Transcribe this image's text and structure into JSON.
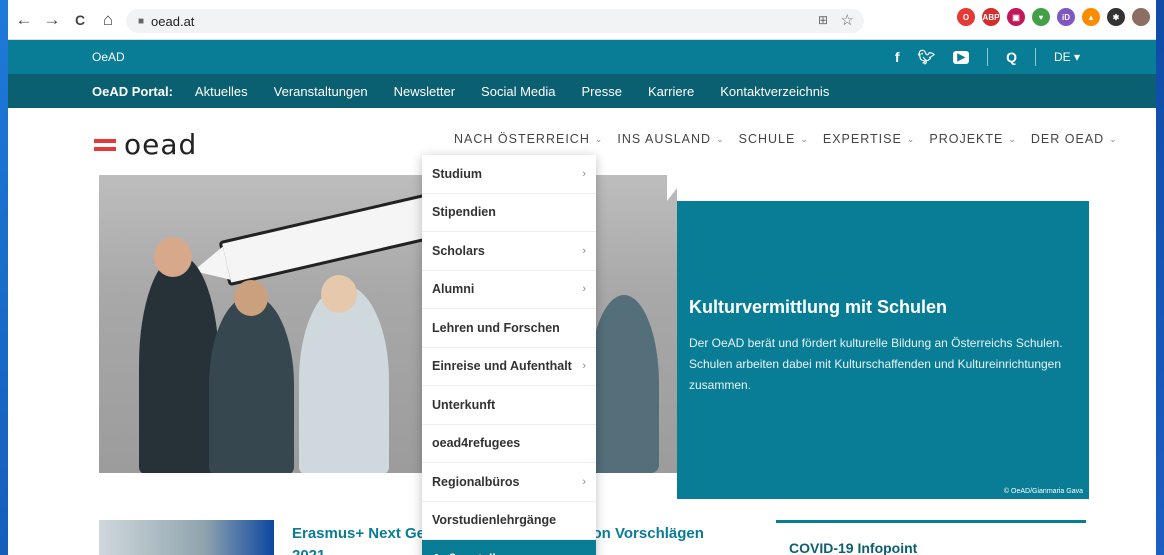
{
  "browser": {
    "url": "oead.at",
    "back": "←",
    "forward": "→",
    "reload": "C",
    "home": "⌂",
    "lock": "🔒",
    "translate": "⊞",
    "star": "☆"
  },
  "extensions": [
    {
      "name": "opera-icon",
      "color": "#e53935",
      "glyph": "O"
    },
    {
      "name": "adblock-icon",
      "color": "#d32f2f",
      "glyph": "ABP"
    },
    {
      "name": "pocket-icon",
      "color": "#c2185b",
      "glyph": "▣"
    },
    {
      "name": "shield-ext-icon",
      "color": "#43a047",
      "glyph": "♥"
    },
    {
      "name": "id-ext-icon",
      "color": "#7e57c2",
      "glyph": "iD"
    },
    {
      "name": "vlc-ext-icon",
      "color": "#fb8c00",
      "glyph": "▲"
    },
    {
      "name": "puzzle-icon",
      "color": "#333",
      "glyph": "✱"
    },
    {
      "name": "profile-avatar",
      "color": "#8d6e63",
      "glyph": ""
    }
  ],
  "topbar": {
    "brand": "OeAD",
    "facebook": "f",
    "twitter": "✓",
    "youtube": "▶",
    "search": "Q",
    "lang": "DE ▾"
  },
  "portal": {
    "label": "OeAD Portal:",
    "links": [
      "Aktuelles",
      "Veranstaltungen",
      "Newsletter",
      "Social Media",
      "Presse",
      "Karriere",
      "Kontaktverzeichnis"
    ]
  },
  "logo": {
    "word": "oead"
  },
  "mainnav": [
    {
      "label": "NACH ÖSTERREICH"
    },
    {
      "label": "INS AUSLAND"
    },
    {
      "label": "SCHULE"
    },
    {
      "label": "EXPERTISE"
    },
    {
      "label": "PROJEKTE"
    },
    {
      "label": "DER OEAD"
    }
  ],
  "chevron": "⌄",
  "dropdown": [
    {
      "label": "Studium",
      "arrow": true
    },
    {
      "label": "Stipendien",
      "arrow": false
    },
    {
      "label": "Scholars",
      "arrow": true
    },
    {
      "label": "Alumni",
      "arrow": true
    },
    {
      "label": "Lehren und Forschen",
      "arrow": false
    },
    {
      "label": "Einreise und Aufenthalt",
      "arrow": true
    },
    {
      "label": "Unterkunft",
      "arrow": false
    },
    {
      "label": "oead4refugees",
      "arrow": false
    },
    {
      "label": "Regionalbüros",
      "arrow": true
    },
    {
      "label": "Vorstudienlehrgänge",
      "arrow": false
    },
    {
      "label": "Außenstellen",
      "arrow": true,
      "active": true
    }
  ],
  "hero": {
    "title": "Kulturvermittlung mit Schulen",
    "text": "Der OeAD berät und fördert kulturelle Bildung an Österreichs Schulen. Schulen arbeiten dabei mit Kulturschaffenden und Kultureinrichtungen zusammen.",
    "credit": "© OeAD/Gianmaria Gava"
  },
  "news": {
    "title": "Erasmus+ Next Generation: Einreichung von Vorschlägen 2021"
  },
  "covid": {
    "title": "COVID-19 Infopoint"
  }
}
